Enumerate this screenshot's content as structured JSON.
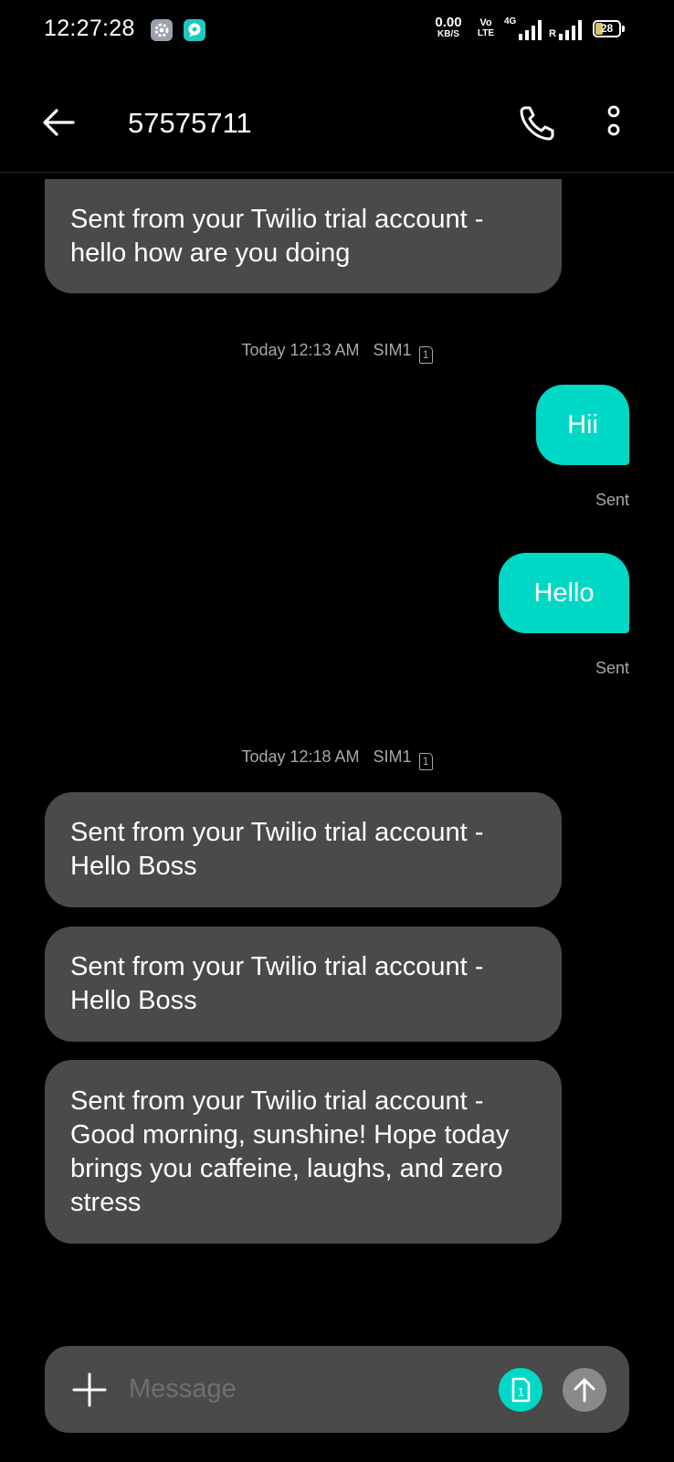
{
  "status_bar": {
    "time": "12:27:28",
    "net_speed_value": "0.00",
    "net_speed_unit": "KB/S",
    "volte_top": "Vo",
    "volte_bottom": "LTE",
    "network_type": "4G",
    "roaming": "R",
    "battery_level": "28",
    "battery_fraction": 0.28,
    "icons": [
      "settings-icon",
      "chat-app-icon",
      "signal-icon",
      "battery-icon"
    ]
  },
  "app_bar": {
    "title": "57575711",
    "back_icon": "arrow-left-icon",
    "call_icon": "phone-icon",
    "more_icon": "more-vertical-icon"
  },
  "conversation": {
    "messages_top": [
      {
        "direction": "incoming",
        "lines": [
          "Sent from your Twilio trial account -",
          "hello how are you doing"
        ]
      }
    ],
    "separator_1": {
      "time": "Today 12:13 AM",
      "sim": "SIM1",
      "sim_slot": "1"
    },
    "outgoing": [
      {
        "text": "Hii",
        "status": "Sent"
      },
      {
        "text": "Hello",
        "status": "Sent"
      }
    ],
    "separator_2": {
      "time": "Today 12:18 AM",
      "sim": "SIM1",
      "sim_slot": "1"
    },
    "incoming": [
      {
        "lines": [
          "Sent from your Twilio trial account -",
          "Hello Boss"
        ]
      },
      {
        "lines": [
          "Sent from your Twilio trial account -",
          "Hello Boss"
        ]
      },
      {
        "lines": [
          "Sent from your Twilio trial account -",
          "Good morning, sunshine! Hope today",
          "brings you caffeine, laughs, and zero",
          "stress"
        ]
      }
    ]
  },
  "composer": {
    "placeholder": "Message",
    "value": "",
    "sim_slot": "1",
    "add_icon": "plus-icon",
    "send_icon": "arrow-up-icon"
  },
  "colors": {
    "background": "#000000",
    "incoming_bubble": "#4a4a4a",
    "outgoing_bubble": "#00d8c6",
    "meta_text": "#a8a8a8",
    "send_disabled": "#8a8a8a"
  }
}
